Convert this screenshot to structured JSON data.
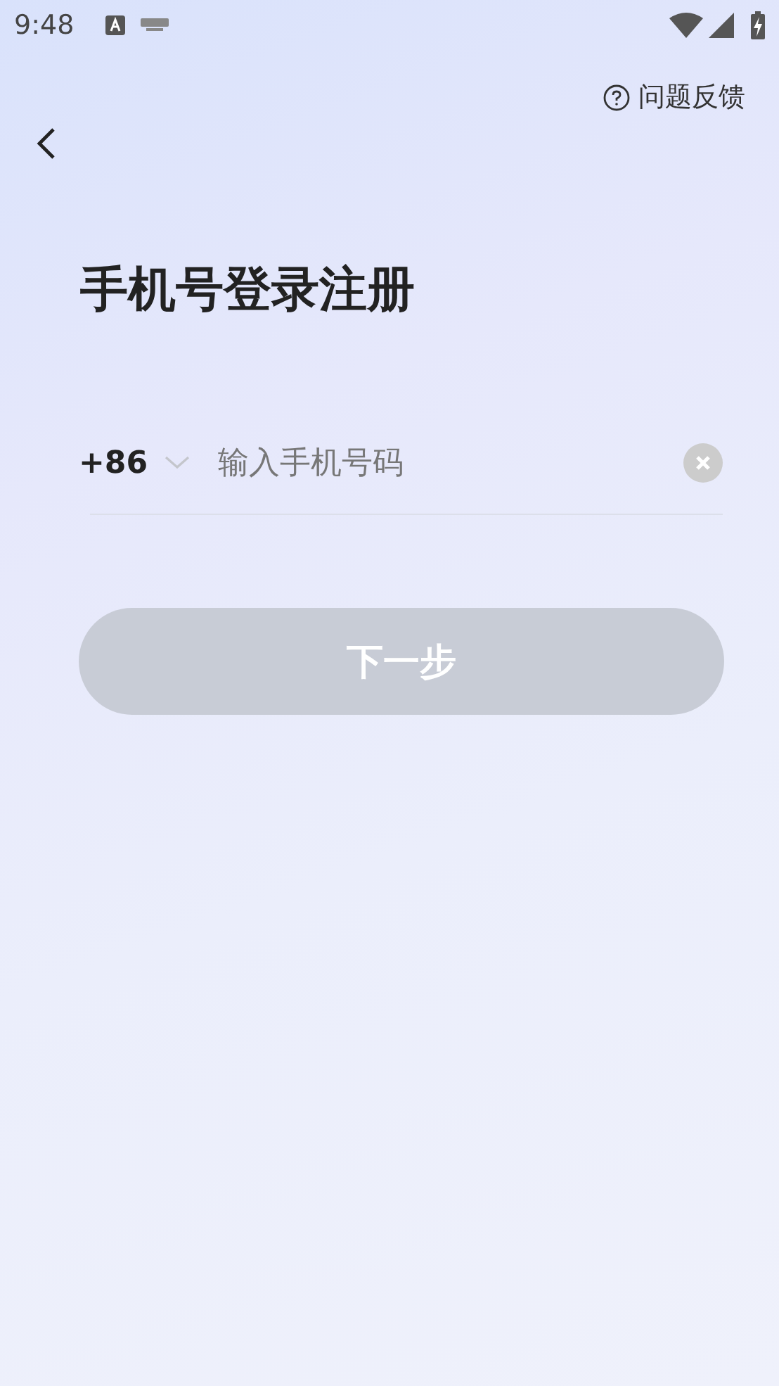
{
  "status_bar": {
    "time": "9:48"
  },
  "header": {
    "feedback": "问题反馈"
  },
  "title": "手机号登录注册",
  "phone": {
    "country_code": "+86",
    "placeholder": "输入手机号码"
  },
  "next_button": {
    "label": "下一步",
    "disabled": true
  }
}
